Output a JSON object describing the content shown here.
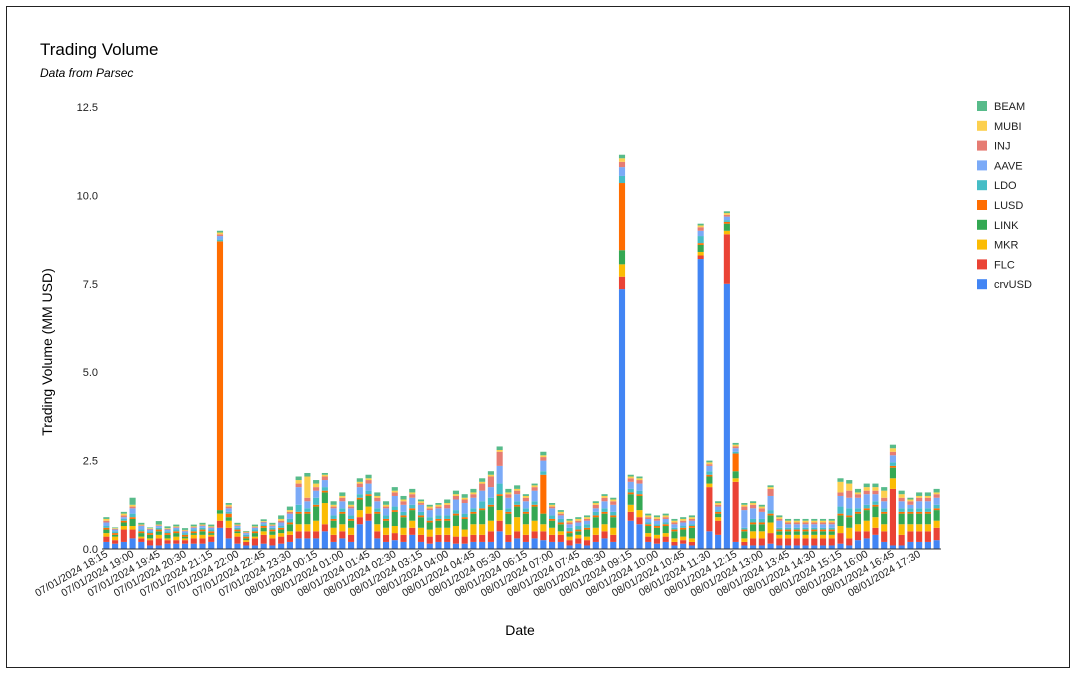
{
  "chart_data": {
    "type": "bar",
    "stacked": true,
    "title": "Trading Volume",
    "subtitle": "Data from Parsec",
    "xlabel": "Date",
    "ylabel": "Trading Volume (MM USD)",
    "ylim": [
      0,
      12.5
    ],
    "yticks": [
      "0.0",
      "2.5",
      "5.0",
      "7.5",
      "10.0",
      "12.5"
    ],
    "grid": false,
    "legend_position": "right",
    "x_tick_labels": [
      "07/01/2024 18:15",
      "07/01/2024 19:00",
      "07/01/2024 19:45",
      "07/01/2024 20:30",
      "07/01/2024 21:15",
      "07/01/2024 22:00",
      "07/01/2024 22:45",
      "07/01/2024 23:30",
      "08/01/2024 00:15",
      "08/01/2024 01:00",
      "08/01/2024 01:45",
      "08/01/2024 02:30",
      "08/01/2024 03:15",
      "08/01/2024 04:00",
      "08/01/2024 04:45",
      "08/01/2024 05:30",
      "08/01/2024 06:15",
      "08/01/2024 07:00",
      "08/01/2024 07:45",
      "08/01/2024 08:30",
      "08/01/2024 09:15",
      "08/01/2024 10:00",
      "08/01/2024 10:45",
      "08/01/2024 11:30",
      "08/01/2024 12:15",
      "08/01/2024 13:00",
      "08/01/2024 13:45",
      "08/01/2024 14:30",
      "08/01/2024 15:15",
      "08/01/2024 16:00",
      "08/01/2024 16:45",
      "08/01/2024 17:30"
    ],
    "bar_count": 96,
    "series": [
      {
        "name": "crvUSD",
        "color": "#4285f4",
        "values": [
          0.2,
          0.15,
          0.2,
          0.3,
          0.2,
          0.1,
          0.1,
          0.15,
          0.15,
          0.15,
          0.15,
          0.15,
          0.2,
          0.6,
          0.3,
          0.15,
          0.1,
          0.1,
          0.15,
          0.1,
          0.15,
          0.2,
          0.3,
          0.3,
          0.3,
          0.5,
          0.2,
          0.3,
          0.2,
          0.7,
          0.8,
          0.3,
          0.2,
          0.25,
          0.2,
          0.4,
          0.2,
          0.15,
          0.2,
          0.2,
          0.15,
          0.15,
          0.2,
          0.2,
          0.2,
          0.5,
          0.2,
          0.3,
          0.2,
          0.3,
          0.25,
          0.2,
          0.2,
          0.1,
          0.15,
          0.1,
          0.2,
          0.3,
          0.2,
          7.35,
          0.8,
          0.7,
          0.2,
          0.15,
          0.2,
          0.1,
          0.15,
          0.1,
          8.2,
          0.5,
          0.4,
          7.5,
          0.2,
          0.1,
          0.1,
          0.1,
          0.15,
          0.1,
          0.1,
          0.1,
          0.1,
          0.1,
          0.1,
          0.1,
          0.15,
          0.1,
          0.25,
          0.3,
          0.4,
          0.2,
          0.1,
          0.1,
          0.2,
          0.2,
          0.2,
          0.25
        ]
      },
      {
        "name": "FLC",
        "color": "#ea4335",
        "values": [
          0.15,
          0.1,
          0.35,
          0.25,
          0.1,
          0.15,
          0.2,
          0.1,
          0.1,
          0.1,
          0.15,
          0.15,
          0.15,
          0.2,
          0.3,
          0.2,
          0.1,
          0.2,
          0.25,
          0.2,
          0.2,
          0.2,
          0.2,
          0.2,
          0.2,
          0.2,
          0.2,
          0.2,
          0.2,
          0.2,
          0.2,
          0.2,
          0.2,
          0.2,
          0.2,
          0.2,
          0.2,
          0.2,
          0.2,
          0.2,
          0.2,
          0.2,
          0.2,
          0.2,
          0.3,
          0.3,
          0.2,
          0.2,
          0.2,
          0.2,
          0.25,
          0.2,
          0.2,
          0.15,
          0.15,
          0.15,
          0.2,
          0.2,
          0.2,
          0.35,
          0.25,
          0.2,
          0.15,
          0.15,
          0.15,
          0.1,
          0.1,
          0.1,
          0.1,
          1.25,
          0.4,
          1.4,
          1.7,
          0.1,
          0.2,
          0.2,
          0.3,
          0.2,
          0.2,
          0.2,
          0.2,
          0.2,
          0.2,
          0.2,
          0.3,
          0.2,
          0.25,
          0.2,
          0.2,
          0.3,
          1.6,
          0.3,
          0.3,
          0.3,
          0.3,
          0.35
        ]
      },
      {
        "name": "MKR",
        "color": "#fbbc04",
        "values": [
          0.1,
          0.1,
          0.1,
          0.1,
          0.05,
          0.05,
          0.1,
          0.05,
          0.1,
          0.05,
          0.1,
          0.1,
          0.05,
          0.2,
          0.2,
          0.1,
          0.05,
          0.05,
          0.1,
          0.1,
          0.1,
          0.1,
          0.2,
          0.2,
          0.3,
          0.6,
          0.2,
          0.2,
          0.2,
          0.2,
          0.2,
          0.2,
          0.2,
          0.2,
          0.2,
          0.2,
          0.2,
          0.2,
          0.2,
          0.2,
          0.3,
          0.2,
          0.3,
          0.3,
          0.3,
          0.3,
          0.3,
          0.4,
          0.3,
          0.3,
          0.2,
          0.2,
          0.1,
          0.1,
          0.1,
          0.1,
          0.2,
          0.2,
          0.2,
          0.35,
          0.2,
          0.2,
          0.1,
          0.1,
          0.1,
          0.1,
          0.1,
          0.1,
          0.1,
          0.1,
          0.1,
          0.1,
          0.1,
          0.1,
          0.2,
          0.2,
          0.3,
          0.1,
          0.1,
          0.1,
          0.1,
          0.1,
          0.1,
          0.1,
          0.2,
          0.3,
          0.2,
          0.3,
          0.3,
          0.2,
          0.3,
          0.3,
          0.2,
          0.2,
          0.2,
          0.2
        ]
      },
      {
        "name": "LINK",
        "color": "#34a853",
        "values": [
          0.1,
          0.05,
          0.1,
          0.2,
          0.1,
          0.1,
          0.1,
          0.1,
          0.1,
          0.05,
          0.05,
          0.1,
          0.05,
          0.1,
          0.1,
          0.05,
          0.05,
          0.1,
          0.1,
          0.1,
          0.1,
          0.2,
          0.3,
          0.3,
          0.4,
          0.3,
          0.2,
          0.3,
          0.2,
          0.3,
          0.3,
          0.3,
          0.2,
          0.4,
          0.3,
          0.3,
          0.3,
          0.2,
          0.2,
          0.2,
          0.3,
          0.3,
          0.3,
          0.4,
          0.4,
          0.4,
          0.3,
          0.3,
          0.3,
          0.4,
          0.3,
          0.2,
          0.2,
          0.1,
          0.1,
          0.2,
          0.3,
          0.3,
          0.3,
          0.4,
          0.3,
          0.4,
          0.2,
          0.2,
          0.2,
          0.2,
          0.2,
          0.3,
          0.2,
          0.2,
          0.1,
          0.2,
          0.2,
          0.2,
          0.2,
          0.2,
          0.2,
          0.1,
          0.1,
          0.1,
          0.1,
          0.1,
          0.1,
          0.1,
          0.3,
          0.3,
          0.3,
          0.3,
          0.3,
          0.3,
          0.3,
          0.3,
          0.3,
          0.3,
          0.3,
          0.3
        ]
      },
      {
        "name": "LUSD",
        "color": "#ff6d01",
        "values": [
          0.05,
          0.05,
          0.05,
          0.05,
          0.05,
          0.05,
          0.05,
          0.05,
          0.05,
          0.05,
          0.05,
          0.05,
          0.05,
          7.6,
          0.1,
          0.05,
          0.05,
          0.05,
          0.05,
          0.05,
          0.05,
          0.05,
          0.05,
          0.05,
          0.05,
          0.05,
          0.05,
          0.05,
          0.05,
          0.05,
          0.05,
          0.05,
          0.05,
          0.05,
          0.05,
          0.05,
          0.05,
          0.05,
          0.05,
          0.05,
          0.05,
          0.05,
          0.05,
          0.05,
          0.05,
          0.05,
          0.05,
          0.05,
          0.05,
          0.05,
          1.1,
          0.05,
          0.05,
          0.05,
          0.05,
          0.05,
          0.05,
          0.05,
          0.05,
          1.9,
          0.05,
          0.05,
          0.05,
          0.05,
          0.05,
          0.05,
          0.05,
          0.05,
          0.05,
          0.05,
          0.05,
          0.05,
          0.5,
          0.05,
          0.05,
          0.05,
          0.05,
          0.05,
          0.05,
          0.05,
          0.05,
          0.05,
          0.05,
          0.05,
          0.05,
          0.05,
          0.05,
          0.05,
          0.05,
          0.05,
          0.05,
          0.05,
          0.05,
          0.05,
          0.05,
          0.05
        ]
      },
      {
        "name": "LDO",
        "color": "#46bdc6",
        "values": [
          0.05,
          0.05,
          0.05,
          0.1,
          0.05,
          0.05,
          0.05,
          0.05,
          0.05,
          0.05,
          0.05,
          0.05,
          0.05,
          0.05,
          0.05,
          0.05,
          0.05,
          0.05,
          0.05,
          0.05,
          0.05,
          0.1,
          0.2,
          0.1,
          0.2,
          0.1,
          0.1,
          0.1,
          0.1,
          0.1,
          0.1,
          0.1,
          0.1,
          0.1,
          0.1,
          0.1,
          0.1,
          0.1,
          0.1,
          0.1,
          0.1,
          0.1,
          0.1,
          0.2,
          0.2,
          0.3,
          0.1,
          0.1,
          0.1,
          0.1,
          0.1,
          0.1,
          0.1,
          0.1,
          0.1,
          0.1,
          0.1,
          0.1,
          0.1,
          0.2,
          0.1,
          0.1,
          0.05,
          0.05,
          0.05,
          0.05,
          0.05,
          0.05,
          0.2,
          0.1,
          0.05,
          0.05,
          0.05,
          0.05,
          0.1,
          0.1,
          0.1,
          0.05,
          0.05,
          0.05,
          0.05,
          0.05,
          0.05,
          0.05,
          0.2,
          0.2,
          0.1,
          0.1,
          0.1,
          0.1,
          0.1,
          0.1,
          0.1,
          0.1,
          0.1,
          0.1
        ]
      },
      {
        "name": "AAVE",
        "color": "#7baaf7",
        "values": [
          0.1,
          0.05,
          0.05,
          0.15,
          0.1,
          0.05,
          0.05,
          0.05,
          0.05,
          0.05,
          0.05,
          0.05,
          0.05,
          0.1,
          0.1,
          0.05,
          0.05,
          0.05,
          0.05,
          0.05,
          0.1,
          0.15,
          0.5,
          0.2,
          0.2,
          0.2,
          0.2,
          0.2,
          0.2,
          0.2,
          0.2,
          0.2,
          0.2,
          0.3,
          0.2,
          0.2,
          0.2,
          0.2,
          0.2,
          0.2,
          0.3,
          0.3,
          0.3,
          0.3,
          0.3,
          0.5,
          0.3,
          0.2,
          0.2,
          0.3,
          0.3,
          0.2,
          0.1,
          0.1,
          0.1,
          0.1,
          0.1,
          0.2,
          0.2,
          0.25,
          0.2,
          0.2,
          0.1,
          0.1,
          0.1,
          0.1,
          0.1,
          0.1,
          0.15,
          0.15,
          0.1,
          0.1,
          0.1,
          0.5,
          0.3,
          0.2,
          0.4,
          0.2,
          0.1,
          0.1,
          0.1,
          0.1,
          0.1,
          0.1,
          0.3,
          0.3,
          0.3,
          0.3,
          0.2,
          0.2,
          0.2,
          0.2,
          0.1,
          0.2,
          0.2,
          0.2
        ]
      },
      {
        "name": "INJ",
        "color": "#e67c73",
        "values": [
          0.05,
          0.02,
          0.05,
          0.05,
          0.02,
          0.02,
          0.02,
          0.02,
          0.02,
          0.02,
          0.02,
          0.02,
          0.02,
          0.05,
          0.05,
          0.02,
          0.02,
          0.02,
          0.02,
          0.02,
          0.05,
          0.05,
          0.1,
          0.1,
          0.1,
          0.1,
          0.05,
          0.1,
          0.05,
          0.1,
          0.1,
          0.1,
          0.05,
          0.1,
          0.1,
          0.1,
          0.05,
          0.05,
          0.05,
          0.1,
          0.1,
          0.1,
          0.1,
          0.2,
          0.3,
          0.4,
          0.1,
          0.1,
          0.1,
          0.1,
          0.1,
          0.05,
          0.05,
          0.05,
          0.05,
          0.05,
          0.1,
          0.1,
          0.1,
          0.15,
          0.1,
          0.1,
          0.05,
          0.05,
          0.05,
          0.05,
          0.05,
          0.05,
          0.1,
          0.05,
          0.05,
          0.05,
          0.05,
          0.1,
          0.1,
          0.1,
          0.2,
          0.05,
          0.05,
          0.05,
          0.05,
          0.05,
          0.05,
          0.05,
          0.1,
          0.2,
          0.1,
          0.1,
          0.1,
          0.1,
          0.1,
          0.1,
          0.1,
          0.1,
          0.1,
          0.1
        ]
      },
      {
        "name": "MUBI",
        "color": "#fcd04f",
        "values": [
          0.05,
          0.02,
          0.05,
          0.05,
          0.02,
          0.02,
          0.02,
          0.02,
          0.02,
          0.02,
          0.02,
          0.02,
          0.02,
          0.05,
          0.05,
          0.02,
          0.02,
          0.02,
          0.02,
          0.02,
          0.05,
          0.05,
          0.1,
          0.6,
          0.1,
          0.05,
          0.05,
          0.05,
          0.05,
          0.05,
          0.05,
          0.05,
          0.05,
          0.05,
          0.05,
          0.05,
          0.05,
          0.05,
          0.05,
          0.05,
          0.05,
          0.05,
          0.05,
          0.05,
          0.05,
          0.05,
          0.05,
          0.05,
          0.05,
          0.05,
          0.05,
          0.05,
          0.05,
          0.05,
          0.05,
          0.05,
          0.05,
          0.05,
          0.05,
          0.1,
          0.05,
          0.05,
          0.05,
          0.05,
          0.05,
          0.05,
          0.05,
          0.05,
          0.05,
          0.05,
          0.05,
          0.05,
          0.05,
          0.05,
          0.05,
          0.05,
          0.05,
          0.05,
          0.05,
          0.05,
          0.05,
          0.05,
          0.05,
          0.05,
          0.3,
          0.2,
          0.05,
          0.1,
          0.1,
          0.2,
          0.1,
          0.1,
          0.05,
          0.05,
          0.05,
          0.05
        ]
      },
      {
        "name": "BEAM",
        "color": "#57bb8a",
        "values": [
          0.05,
          0.02,
          0.05,
          0.2,
          0.05,
          0.02,
          0.1,
          0.05,
          0.05,
          0.05,
          0.05,
          0.05,
          0.05,
          0.05,
          0.05,
          0.05,
          0.02,
          0.05,
          0.05,
          0.05,
          0.1,
          0.1,
          0.1,
          0.1,
          0.1,
          0.05,
          0.1,
          0.1,
          0.1,
          0.1,
          0.1,
          0.1,
          0.1,
          0.1,
          0.1,
          0.1,
          0.05,
          0.05,
          0.05,
          0.1,
          0.1,
          0.1,
          0.1,
          0.1,
          0.1,
          0.1,
          0.1,
          0.1,
          0.05,
          0.05,
          0.1,
          0.05,
          0.05,
          0.05,
          0.05,
          0.05,
          0.05,
          0.05,
          0.05,
          0.1,
          0.05,
          0.05,
          0.05,
          0.05,
          0.05,
          0.05,
          0.05,
          0.05,
          0.05,
          0.05,
          0.05,
          0.05,
          0.05,
          0.05,
          0.05,
          0.05,
          0.05,
          0.05,
          0.05,
          0.05,
          0.05,
          0.05,
          0.05,
          0.05,
          0.1,
          0.1,
          0.1,
          0.1,
          0.1,
          0.1,
          0.1,
          0.1,
          0.05,
          0.1,
          0.1,
          0.1
        ]
      }
    ]
  }
}
